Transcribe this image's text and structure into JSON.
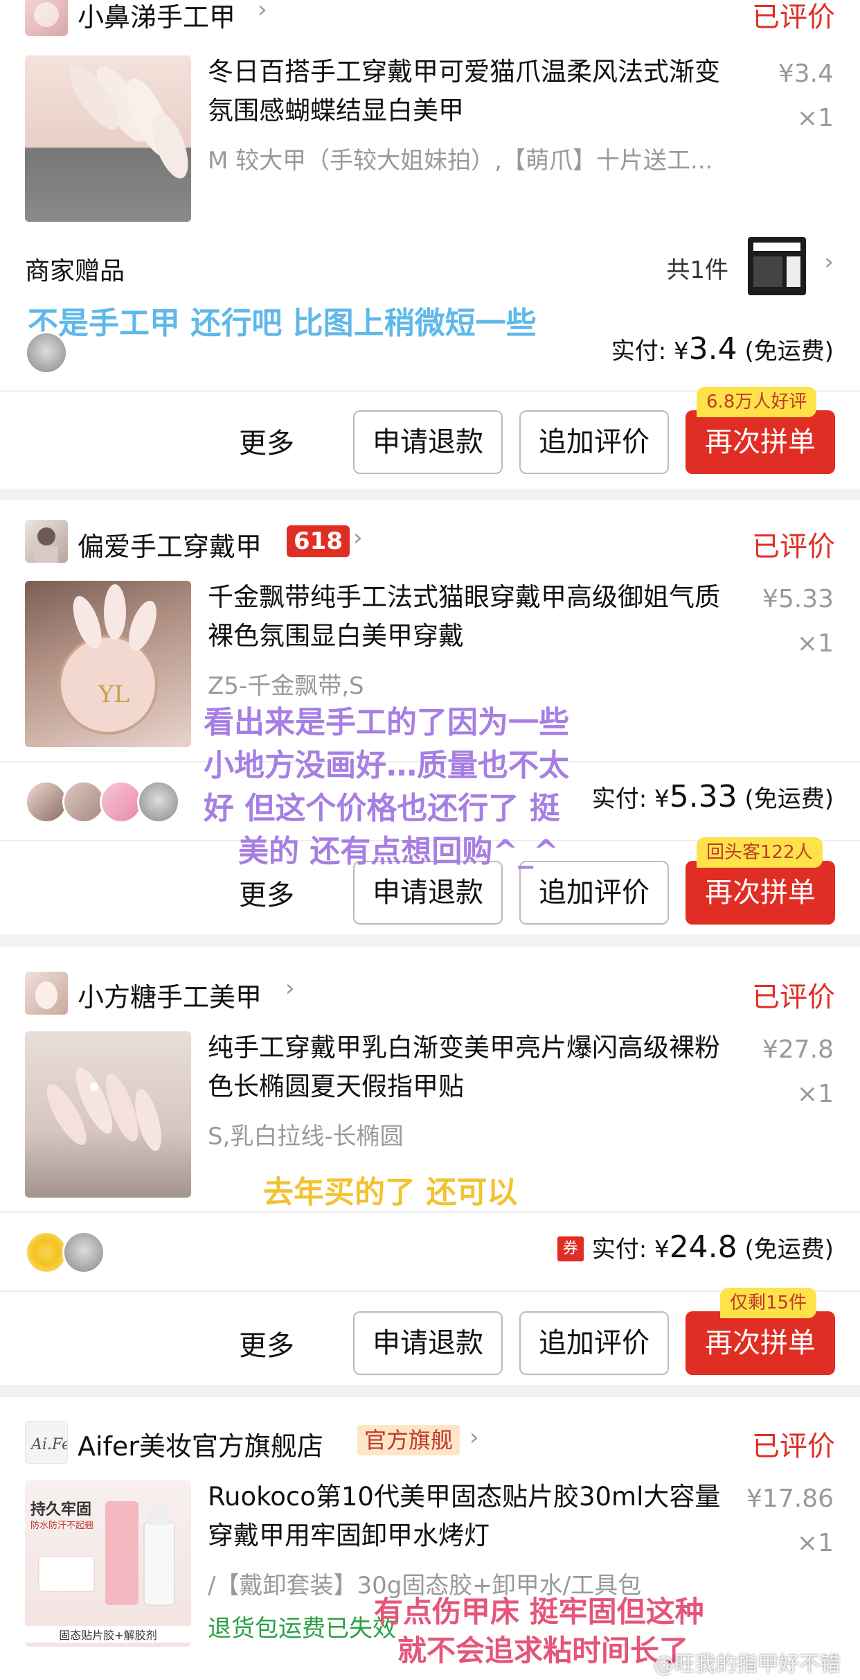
{
  "orders": [
    {
      "shop_name": "小鼻涕手工甲",
      "status": "已评价",
      "product_title": "冬日百搭手工穿戴甲可爱猫爪温柔风法式渐变氛围感蝴蝶结显白美甲",
      "product_spec": "M 较大甲（手较大姐妹拍）,【萌爪】十片送工...",
      "unit_price": "¥3.4",
      "quantity": "×1",
      "gift_label": "商家赠品",
      "gift_count": "共1件",
      "paid_label": "实付:",
      "paid_currency": "¥",
      "paid_amount": "3.4",
      "shipping": "(免运费)",
      "more_label": "更多",
      "refund_label": "申请退款",
      "review_label": "追加评价",
      "rebuy_label": "再次拼单",
      "tag": "6.8万人好评",
      "note": "不是手工甲 还行吧 比图上稍微短一些"
    },
    {
      "shop_name": "偏爱手工穿戴甲",
      "shop_badge": "618",
      "status": "已评价",
      "product_title": "千金飘带纯手工法式猫眼穿戴甲高级御姐气质裸色氛围显白美甲穿戴",
      "product_spec": "Z5-千金飘带,S",
      "unit_price": "¥5.33",
      "quantity": "×1",
      "paid_label": "实付:",
      "paid_currency": "¥",
      "paid_amount": "5.33",
      "shipping": "(免运费)",
      "more_label": "更多",
      "refund_label": "申请退款",
      "review_label": "追加评价",
      "rebuy_label": "再次拼单",
      "tag": "回头客122人",
      "note_lines": [
        "看出来是手工的了因为一些",
        "小地方没画好…质量也不太",
        "好 但这个价格也还行了 挺",
        "美的 还有点想回购^_^"
      ]
    },
    {
      "shop_name": "小方糖手工美甲",
      "status": "已评价",
      "product_title": "纯手工穿戴甲乳白渐变美甲亮片爆闪高级裸粉色长椭圆夏天假指甲贴",
      "product_spec": "S,乳白拉线-长椭圆",
      "unit_price": "¥27.8",
      "quantity": "×1",
      "coupon": "券",
      "paid_label": "实付:",
      "paid_currency": "¥",
      "paid_amount": "24.8",
      "shipping": "(免运费)",
      "more_label": "更多",
      "refund_label": "申请退款",
      "review_label": "追加评价",
      "rebuy_label": "再次拼单",
      "tag": "仅剩15件",
      "note": "去年买的了 还可以"
    },
    {
      "shop_name": "Aifer美妆官方旗舰店",
      "shop_badge": "官方旗舰",
      "status": "已评价",
      "product_title": "Ruokoco第10代美甲固态贴片胶30ml大容量穿戴甲用牢固卸甲水烤灯",
      "product_spec": "/【戴卸套装】30g固态胶+卸甲水/工具包",
      "unit_price": "¥17.86",
      "quantity": "×1",
      "return_note": "退货包运费已失效",
      "thumb_text": [
        "持久牢固",
        "防水防汗不起翘",
        "固态贴片胶+解胶剂"
      ],
      "note_lines": [
        "有点伤甲床 挺牢固但这种",
        "就不会追求粘时间长了"
      ]
    }
  ],
  "watermark": "@旺我的指甲好不错",
  "colors": {
    "accent": "#e02e24",
    "note_blue": "#5fb8ea",
    "note_purple": "#a77ee3",
    "note_gold": "#f2c231",
    "note_pink": "#e5557a"
  }
}
